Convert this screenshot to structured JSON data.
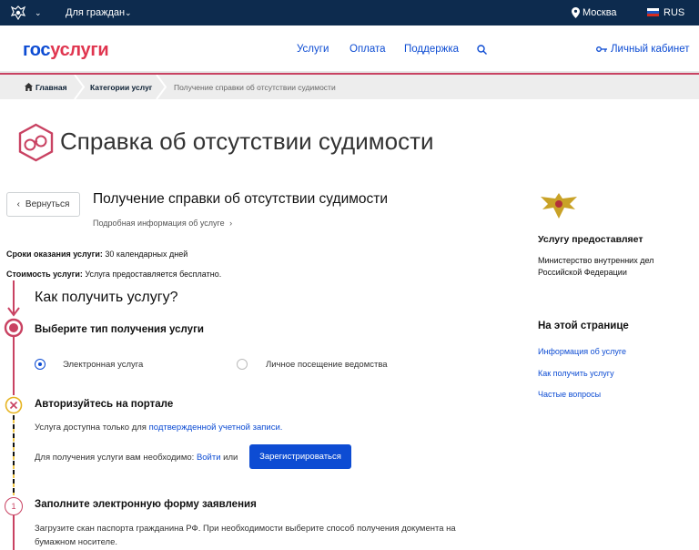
{
  "topbar": {
    "for_citizens": "Для граждан",
    "city": "Москва",
    "lang": "RUS",
    "colors": {
      "background": "#0d2b4e"
    }
  },
  "header": {
    "logo_part1": "гос",
    "logo_part2": "услуги",
    "nav": [
      "Услуги",
      "Оплата",
      "Поддержка"
    ],
    "login": "Личный кабинет",
    "colors": {
      "accent": "#0d4cd3",
      "brand_red": "#e0354f",
      "divider": "#c94262"
    }
  },
  "breadcrumb": {
    "home": "Главная",
    "categories": "Категории услуг",
    "current": "Получение справки об отсутствии судимости"
  },
  "page": {
    "title": "Справка об отсутствии судимости",
    "back": "Вернуться",
    "service_title": "Получение справки об отсутствии судимости",
    "more_info": "Подробная информация об услуге",
    "term_label": "Сроки оказания услуги:",
    "term_value": "30 календарных дней",
    "cost_label": "Стоимость услуги:",
    "cost_value": "Услуга предоставляется бесплатно.",
    "how_title": "Как получить услугу?"
  },
  "steps": {
    "type": {
      "title": "Выберите тип получения услуги",
      "options": [
        "Электронная услуга",
        "Личное посещение ведомства"
      ],
      "selected": "Электронная услуга"
    },
    "auth": {
      "title": "Авторизуйтесь на портале",
      "text1": "Услуга доступна только для",
      "text1_link": "подтвержденной учетной записи.",
      "text2": "Для получения услуги вам необходимо:",
      "login_link": "Войти",
      "or": "или",
      "register": "Зарегистрироваться"
    },
    "form": {
      "number": "1",
      "title": "Заполните электронную форму заявления",
      "text": "Загрузите скан паспорта гражданина РФ. При необходимости выберите способ получения документа на бумажном носителе."
    }
  },
  "sidebar": {
    "provider_heading": "Услугу предоставляет",
    "provider_name": "Министерство внутренних дел Российской Федерации",
    "on_page_heading": "На этой странице",
    "links": [
      "Информация об услуге",
      "Как получить услугу",
      "Частые вопросы"
    ]
  }
}
